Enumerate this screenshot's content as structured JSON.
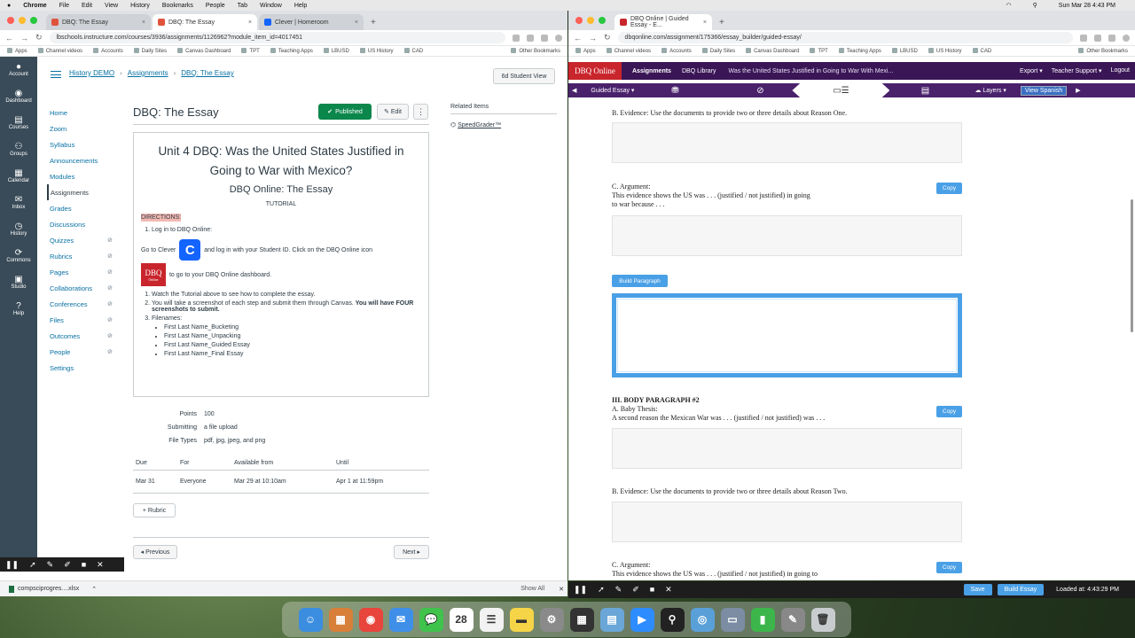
{
  "menubar": {
    "app": "Chrome",
    "items": [
      "File",
      "Edit",
      "View",
      "History",
      "Bookmarks",
      "People",
      "Tab",
      "Window",
      "Help"
    ],
    "clock": "Sun Mar 28 4:43 PM"
  },
  "left_browser": {
    "tabs": [
      {
        "title": "DBQ: The Essay",
        "color": "#e0533d"
      },
      {
        "title": "DBQ: The Essay",
        "color": "#e0533d"
      },
      {
        "title": "Clever | Homeroom",
        "color": "#1464ff"
      }
    ],
    "url": "lbschools.instructure.com/courses/3936/assignments/1126962?module_item_id=4017451",
    "bookmarks": [
      "Apps",
      "Channel videos",
      "Accounts",
      "Daily Sites",
      "Canvas Dashboard",
      "TPT",
      "Teaching Apps",
      "LBUSD",
      "US History",
      "CAD"
    ],
    "other_bookmarks": "Other Bookmarks"
  },
  "right_browser": {
    "tabs": [
      {
        "title": "DBQ Online | Guided Essay - E...",
        "color": "#c9252c"
      }
    ],
    "url": "dbqonline.com/assignment/175366/essay_builder/guided-essay/",
    "bookmarks": [
      "Apps",
      "Channel videos",
      "Accounts",
      "Daily Sites",
      "Canvas Dashboard",
      "TPT",
      "Teaching Apps",
      "LBUSD",
      "US History",
      "CAD"
    ],
    "other_bookmarks": "Other Bookmarks"
  },
  "canvas": {
    "global_nav": [
      {
        "label": "Account",
        "icon": "●"
      },
      {
        "label": "Dashboard",
        "icon": "◉"
      },
      {
        "label": "Courses",
        "icon": "▤"
      },
      {
        "label": "Groups",
        "icon": "⚇"
      },
      {
        "label": "Calendar",
        "icon": "▦"
      },
      {
        "label": "Inbox",
        "icon": "✉"
      },
      {
        "label": "History",
        "icon": "◷"
      },
      {
        "label": "Commons",
        "icon": "⟳"
      },
      {
        "label": "Studio",
        "icon": "▣"
      },
      {
        "label": "Help",
        "icon": "?"
      }
    ],
    "breadcrumb": [
      "History DEMO",
      "Assignments",
      "DBQ: The Essay"
    ],
    "student_view": "6d Student View",
    "course_nav": [
      {
        "label": "Home",
        "hidden": false
      },
      {
        "label": "Zoom",
        "hidden": false
      },
      {
        "label": "Syllabus",
        "hidden": false
      },
      {
        "label": "Announcements",
        "hidden": false
      },
      {
        "label": "Modules",
        "hidden": false
      },
      {
        "label": "Assignments",
        "hidden": false,
        "active": true
      },
      {
        "label": "Grades",
        "hidden": false
      },
      {
        "label": "Discussions",
        "hidden": false
      },
      {
        "label": "Quizzes",
        "hidden": true
      },
      {
        "label": "Rubrics",
        "hidden": true
      },
      {
        "label": "Pages",
        "hidden": true
      },
      {
        "label": "Collaborations",
        "hidden": true
      },
      {
        "label": "Conferences",
        "hidden": true
      },
      {
        "label": "Files",
        "hidden": true
      },
      {
        "label": "Outcomes",
        "hidden": true
      },
      {
        "label": "People",
        "hidden": true
      },
      {
        "label": "Settings",
        "hidden": false
      }
    ],
    "page_title": "DBQ: The Essay",
    "published": "Published",
    "edit": "Edit",
    "kebab": "⋮",
    "related_heading": "Related Items",
    "related_link": "SpeedGrader™",
    "description": {
      "heading": "Unit 4 DBQ: Was the United States Justified in Going to War with Mexico?",
      "subheading": "DBQ Online: The Essay",
      "tutorial": "TUTORIAL",
      "directions": "DIRECTIONS:",
      "step1": "Log in to DBQ Online:",
      "goto_before": "Go to Clever",
      "goto_after": "and log in with your Student ID. Click on the DBQ Online icon",
      "clever_letter": "C",
      "dbq_logo": "DBQ",
      "dbq_logo_sub": "Online",
      "dashboard_text": "to go to your DBQ Online dashboard.",
      "steps": [
        "Watch the Tutorial above to see how to complete the essay.",
        "You will take a screenshot of each step and submit them through Canvas.",
        "Filenames:"
      ],
      "steps_bold": "You will have FOUR screenshots to submit.",
      "filenames": [
        "First Last Name_Bucketing",
        "First Last Name_Unpacking",
        "First Last Name_Guided Essay",
        "First Last Name_Final Essay"
      ]
    },
    "details": [
      {
        "key": "Points",
        "value": "100"
      },
      {
        "key": "Submitting",
        "value": "a file upload"
      },
      {
        "key": "File Types",
        "value": "pdf, jpg, jpeg, and png"
      }
    ],
    "due_table": {
      "headers": [
        "Due",
        "For",
        "Available from",
        "Until"
      ],
      "row": [
        "Mar 31",
        "Everyone",
        "Mar 29 at 10:10am",
        "Apr 1 at 11:59pm"
      ]
    },
    "rubric": "+ Rubric",
    "previous": "◂ Previous",
    "next": "Next ▸"
  },
  "dbq": {
    "logo": "DBQ Online",
    "nav": [
      "Assignments",
      "DBQ Library"
    ],
    "title": "Was the United States Justified in Going to War With Mexi...",
    "nav_right": [
      "Export ▾",
      "Teacher Support ▾",
      "Logout"
    ],
    "guided": "Guided Essay ▾",
    "layers": "Layers ▾",
    "view_spanish": "View Spanish",
    "sections": {
      "evidence_one": "B. Evidence: Use the documents to provide two or three details about Reason One.",
      "argument_label": "C. Argument:",
      "argument_text": "This evidence shows the US was . . . (justified / not justified) in going",
      "argument_text2": "to war because . . .",
      "build_paragraph": "Build Paragraph",
      "body2_title": "III. BODY PARAGRAPH #2",
      "baby_thesis": "A. Baby Thesis:",
      "second_reason": "A second reason the Mexican War was . . . (justified / not justified) was . . .",
      "evidence_two": "B. Evidence: Use the documents to provide two or three details about Reason Two.",
      "argument2_label": "C. Argument:",
      "argument2_text": "This evidence shows the US was . . . (justified / not justified) in going to",
      "copy": "Copy"
    },
    "save": "Save",
    "build_essay": "Build Essay",
    "loaded": "Loaded at: 4:43:29 PM"
  },
  "downloads": {
    "file": "compsciprogres....xlsx",
    "show_all": "Show All"
  },
  "dock": [
    {
      "name": "finder-icon",
      "color": "#3b8de0",
      "glyph": "☺"
    },
    {
      "name": "launchpad-icon",
      "color": "#d87f3a",
      "glyph": "▦"
    },
    {
      "name": "chrome-icon",
      "color": "#e8453c",
      "glyph": "◉"
    },
    {
      "name": "mail-icon",
      "color": "#3f8fe8",
      "glyph": "✉"
    },
    {
      "name": "messages-icon",
      "color": "#3fc34c",
      "glyph": "💬"
    },
    {
      "name": "calendar-icon",
      "color": "#ffffff",
      "glyph": "28"
    },
    {
      "name": "reminders-icon",
      "color": "#f2f2f2",
      "glyph": "☰"
    },
    {
      "name": "notes-icon",
      "color": "#f5d547",
      "glyph": "▬"
    },
    {
      "name": "settings-icon",
      "color": "#8a8a8a",
      "glyph": "⚙"
    },
    {
      "name": "calculator-icon",
      "color": "#333333",
      "glyph": "▦"
    },
    {
      "name": "preview-icon",
      "color": "#6aa6d8",
      "glyph": "▤"
    },
    {
      "name": "zoom-icon",
      "color": "#2d8cff",
      "glyph": "▶"
    },
    {
      "name": "reader-icon",
      "color": "#222222",
      "glyph": "⚲"
    },
    {
      "name": "quicktime-icon",
      "color": "#5aa0d8",
      "glyph": "◎"
    },
    {
      "name": "screenshot-icon",
      "color": "#7b8ca3",
      "glyph": "▭"
    },
    {
      "name": "numbers-icon",
      "color": "#3cb64a",
      "glyph": "▮"
    },
    {
      "name": "pen-icon",
      "color": "#888888",
      "glyph": "✎"
    },
    {
      "name": "trash-icon",
      "color": "#c9ccce",
      "glyph": "🗑"
    }
  ]
}
